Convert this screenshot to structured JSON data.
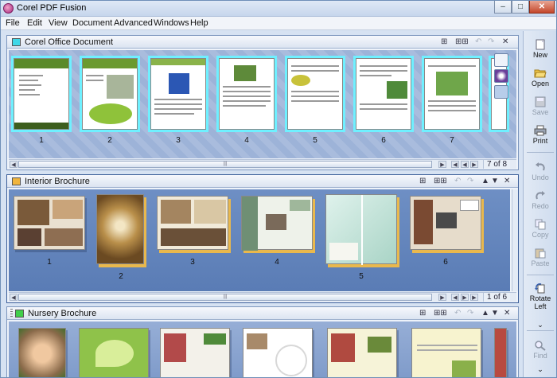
{
  "window": {
    "title": "Corel PDF Fusion",
    "minimize": "–",
    "maximize": "□",
    "close": "✕"
  },
  "menu": [
    "File",
    "Edit",
    "View",
    "Document",
    "Advanced",
    "Windows",
    "Help"
  ],
  "panels": [
    {
      "title": "Corel Office Document",
      "icon_color": "#3fd8e8",
      "page_indicator": "7 of 8",
      "pages": [
        "1",
        "2",
        "3",
        "4",
        "5",
        "6",
        "7"
      ]
    },
    {
      "title": "Interior Brochure",
      "icon_color": "#f0b43c",
      "page_indicator": "1 of 6",
      "pages": [
        "1",
        "2",
        "3",
        "4",
        "5",
        "6"
      ]
    },
    {
      "title": "Nursery Brochure",
      "icon_color": "#3fcf4a",
      "pages": []
    }
  ],
  "toolbar": [
    {
      "label": "New",
      "icon": "new-page-icon",
      "enabled": true
    },
    {
      "label": "Open",
      "icon": "folder-open-icon",
      "enabled": true
    },
    {
      "label": "Save",
      "icon": "save-icon",
      "enabled": false
    },
    {
      "label": "Print",
      "icon": "printer-icon",
      "enabled": true
    },
    {
      "label": "Undo",
      "icon": "undo-icon",
      "enabled": false
    },
    {
      "label": "Redo",
      "icon": "redo-icon",
      "enabled": false
    },
    {
      "label": "Copy",
      "icon": "copy-icon",
      "enabled": false
    },
    {
      "label": "Paste",
      "icon": "paste-icon",
      "enabled": false
    },
    {
      "label": "Rotate Left",
      "icon": "rotate-left-icon",
      "enabled": true
    },
    {
      "label": "Find",
      "icon": "find-icon",
      "enabled": false
    }
  ],
  "colors": {
    "selection_cyan": "#6ff0ff",
    "selection_gold": "#e9b84d",
    "panel_bg": "#8aa5d1"
  }
}
